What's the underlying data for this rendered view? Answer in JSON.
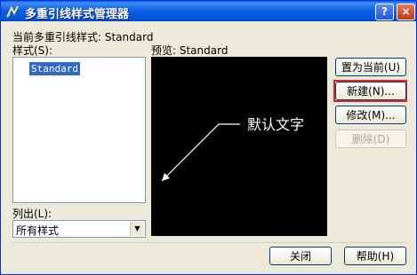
{
  "window": {
    "title": "多重引线样式管理器",
    "help_button": "?",
    "close_button": "×"
  },
  "current_style": {
    "label": "当前多重引线样式: Standard"
  },
  "styles": {
    "label": "样式(S):",
    "items": [
      "Standard"
    ],
    "selected": "Standard"
  },
  "preview": {
    "label": "预览: Standard",
    "sample_text": "默认文字"
  },
  "list_filter": {
    "label": "列出(L):",
    "value": "所有样式"
  },
  "buttons": {
    "set_current": "置为当前(U)",
    "new": "新建(N)...",
    "modify": "修改(M)...",
    "delete": "删除(D)",
    "close": "关闭",
    "help": "帮助(H)"
  },
  "colors": {
    "title_bar": "#0a5fe6",
    "selection": "#316ac5",
    "preview_background": "#000000",
    "highlight": "#e0202c"
  }
}
